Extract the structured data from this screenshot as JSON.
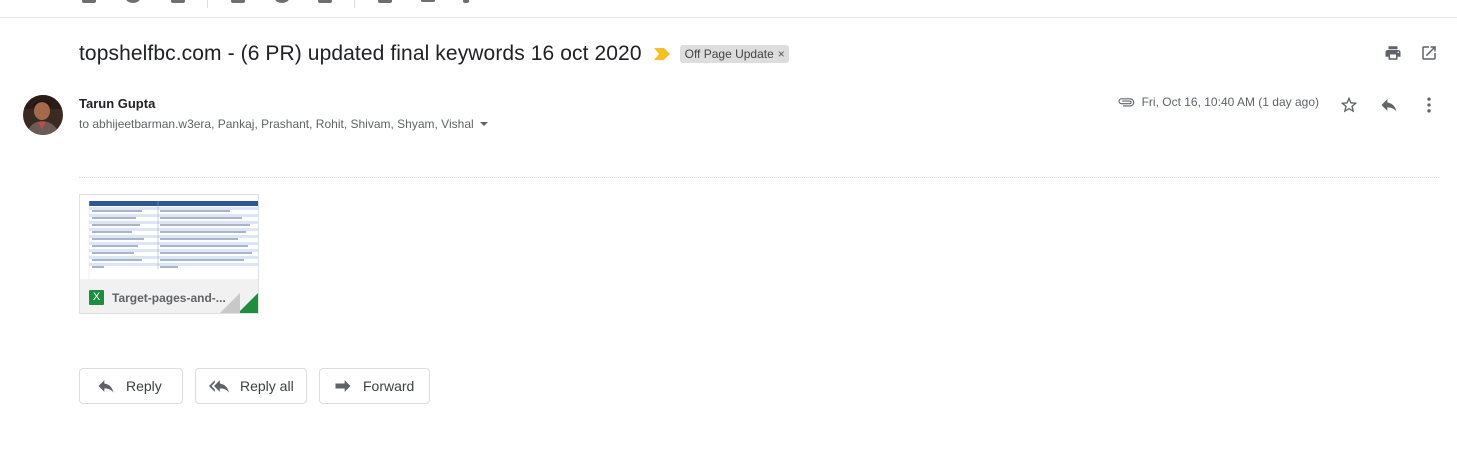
{
  "email": {
    "subject": "topshelfbc.com - (6 PR) updated final keywords 16 oct 2020",
    "label": "Off Page Update",
    "label_close": "×",
    "sender": "Tarun Gupta",
    "recipients": "to abhijeetbarman.w3era, Pankaj, Prashant, Rohit, Shivam, Shyam, Vishal",
    "date": "Fri, Oct 16, 10:40 AM (1 day ago)"
  },
  "attachment": {
    "name": "Target-pages-and-...",
    "type_icon_letter": "X",
    "icon": "excel-file-icon"
  },
  "actions": {
    "reply": "Reply",
    "reply_all": "Reply all",
    "forward": "Forward"
  },
  "colors": {
    "importance": "#f6c026",
    "label_bg": "#dddddd",
    "excel_green": "#1e8e3e"
  }
}
